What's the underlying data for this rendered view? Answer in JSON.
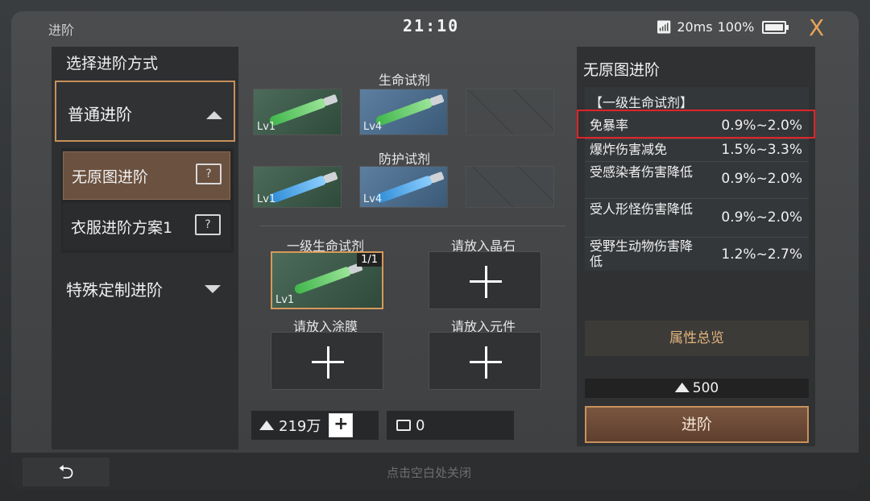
{
  "header": {
    "title": "进阶",
    "clock": "21:10",
    "ping": "20ms",
    "battery": "100%"
  },
  "left": {
    "heading": "选择进阶方式",
    "normal": "普通进阶",
    "sub_items": [
      "无原图进阶",
      "衣服进阶方案1"
    ],
    "special": "特殊定制进阶"
  },
  "middle": {
    "life_title": "生命试剂",
    "protect_title": "防护试剂",
    "life_slots": [
      "Lv1",
      "Lv4"
    ],
    "protect_slots": [
      "Lv1",
      "Lv4"
    ],
    "materials": {
      "selected_label": "一级生命试剂",
      "selected_level": "Lv1",
      "selected_count": "1/1",
      "crystal": "请放入晶石",
      "coating": "请放入涂膜",
      "component": "请放入元件"
    },
    "gold": "219万",
    "plus": "+",
    "chips": "0"
  },
  "right": {
    "title": "无原图进阶",
    "group": "【一级生命试剂】",
    "attrs": [
      {
        "name": "免暴率",
        "value": "0.9%~2.0%"
      },
      {
        "name": "爆炸伤害减免",
        "value": "1.5%~3.3%"
      },
      {
        "name": "受感染者伤害降低",
        "value": "0.9%~2.0%"
      },
      {
        "name": "受人形怪伤害降低",
        "value": "0.9%~2.0%"
      },
      {
        "name": "受野生动物伤害降低",
        "value": "1.2%~2.7%"
      }
    ],
    "overview": "属性总览",
    "cost": "500",
    "advance": "进阶"
  },
  "footer": {
    "back": "⮌",
    "hint": "点击空白处关闭"
  },
  "icons": {
    "close": "X",
    "doc": "?"
  }
}
